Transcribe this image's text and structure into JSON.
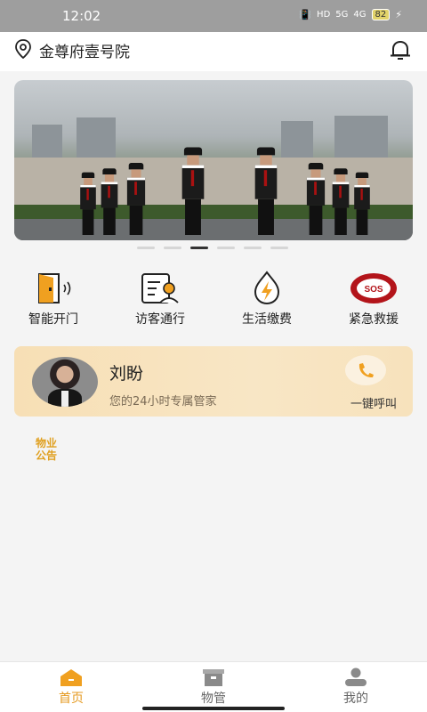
{
  "status_bar": {
    "time": "12:02",
    "network": "HD",
    "signal1": "5G",
    "signal2": "4G",
    "battery": "82"
  },
  "header": {
    "location": "金尊府壹号院"
  },
  "banner": {
    "page_count": 6,
    "active_index": 2
  },
  "quick_actions": [
    {
      "label": "智能开门",
      "icon": "door-icon"
    },
    {
      "label": "访客通行",
      "icon": "visitor-icon"
    },
    {
      "label": "生活缴费",
      "icon": "bolt-icon"
    },
    {
      "label": "紧急救援",
      "icon": "sos-icon",
      "badge": "SOS"
    }
  ],
  "manager": {
    "name": "刘盼",
    "subtitle": "您的24小时专属管家",
    "call_label": "一键呼叫"
  },
  "notice": {
    "label": "物业公告"
  },
  "tabbar": [
    {
      "label": "首页",
      "icon": "home-icon",
      "active": true
    },
    {
      "label": "物管",
      "icon": "property-icon",
      "active": false
    },
    {
      "label": "我的",
      "icon": "user-icon",
      "active": false
    }
  ],
  "colors": {
    "accent": "#e59a20",
    "card": "#f7dfb5",
    "sos": "#b3141a"
  }
}
